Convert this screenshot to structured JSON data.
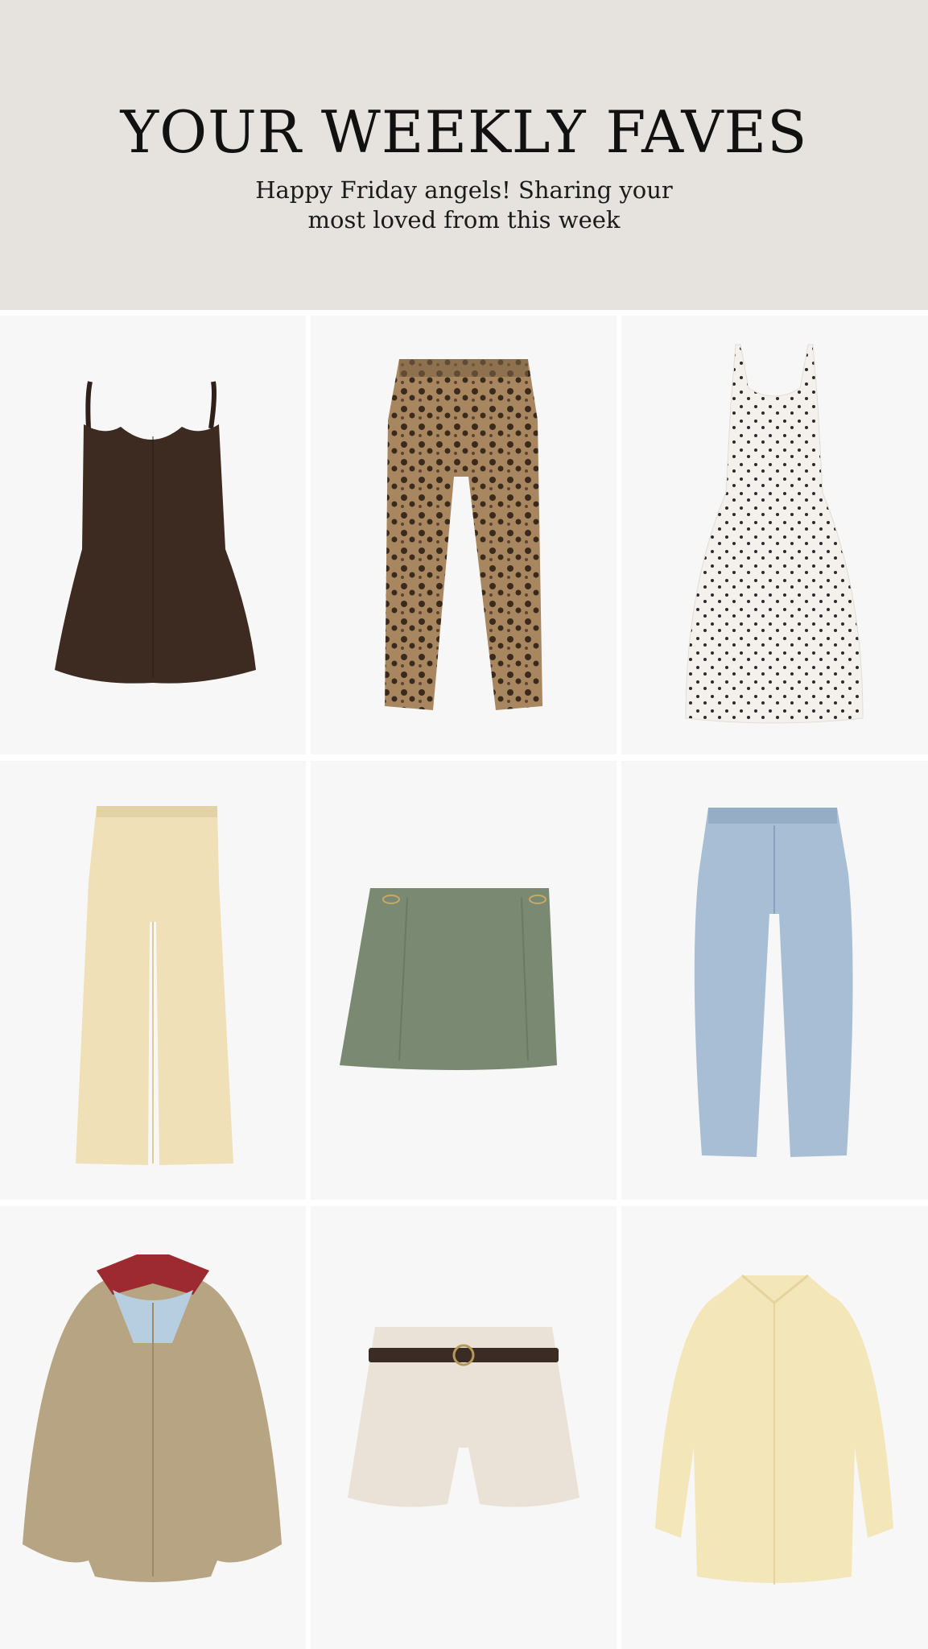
{
  "header": {
    "title": "YOUR WEEKLY FAVES",
    "subtitle_line1": "Happy Friday angels! Sharing your",
    "subtitle_line2": "most loved from this week"
  },
  "colors": {
    "header_bg": "#e6e3df",
    "cell_bg": "#f7f7f7"
  },
  "products": [
    {
      "item": "brown-linen-mini-dress",
      "color": "#3d2a20"
    },
    {
      "item": "leopard-print-jeans",
      "color": "#8a6c4c"
    },
    {
      "item": "white-polka-dot-midi-dress",
      "color": "#f4f1ec"
    },
    {
      "item": "butter-yellow-linen-pants",
      "color": "#efe0b8"
    },
    {
      "item": "sage-green-mini-skirt",
      "color": "#7a8a72"
    },
    {
      "item": "light-wash-barrel-jeans",
      "color": "#a7bed4"
    },
    {
      "item": "tan-scarf-bomber-jacket",
      "color": "#b6a482"
    },
    {
      "item": "cream-belted-shorts",
      "color": "#eae2d6"
    },
    {
      "item": "yellow-linen-button-shirt",
      "color": "#f3e6b8"
    }
  ]
}
